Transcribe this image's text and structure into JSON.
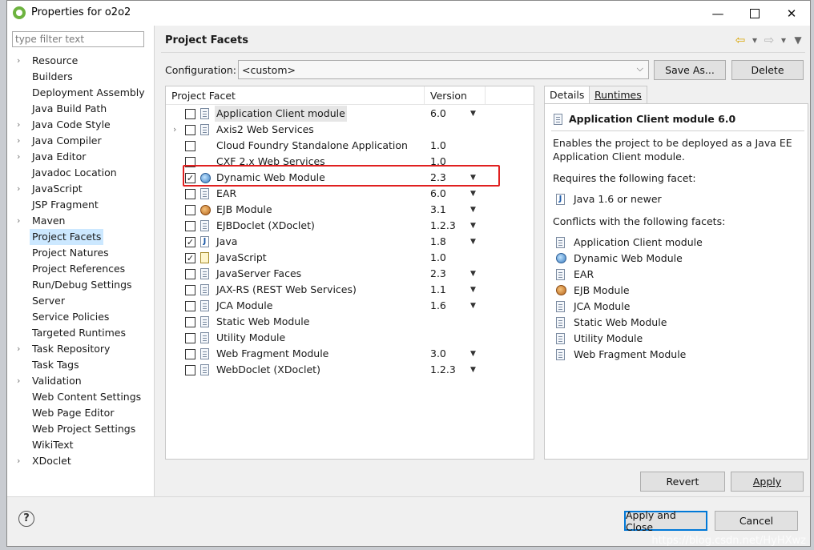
{
  "window": {
    "title": "Properties for o2o2",
    "minimize": "—",
    "close": "✕"
  },
  "filter": {
    "placeholder": "type filter text"
  },
  "tree": [
    {
      "label": "Resource",
      "expandable": true
    },
    {
      "label": "Builders",
      "expandable": false
    },
    {
      "label": "Deployment Assembly",
      "expandable": false
    },
    {
      "label": "Java Build Path",
      "expandable": false
    },
    {
      "label": "Java Code Style",
      "expandable": true
    },
    {
      "label": "Java Compiler",
      "expandable": true
    },
    {
      "label": "Java Editor",
      "expandable": true
    },
    {
      "label": "Javadoc Location",
      "expandable": false
    },
    {
      "label": "JavaScript",
      "expandable": true
    },
    {
      "label": "JSP Fragment",
      "expandable": false
    },
    {
      "label": "Maven",
      "expandable": true
    },
    {
      "label": "Project Facets",
      "expandable": false,
      "selected": true
    },
    {
      "label": "Project Natures",
      "expandable": false
    },
    {
      "label": "Project References",
      "expandable": false
    },
    {
      "label": "Run/Debug Settings",
      "expandable": false
    },
    {
      "label": "Server",
      "expandable": false
    },
    {
      "label": "Service Policies",
      "expandable": false
    },
    {
      "label": "Targeted Runtimes",
      "expandable": false
    },
    {
      "label": "Task Repository",
      "expandable": true
    },
    {
      "label": "Task Tags",
      "expandable": false
    },
    {
      "label": "Validation",
      "expandable": true
    },
    {
      "label": "Web Content Settings",
      "expandable": false
    },
    {
      "label": "Web Page Editor",
      "expandable": false
    },
    {
      "label": "Web Project Settings",
      "expandable": false
    },
    {
      "label": "WikiText",
      "expandable": false
    },
    {
      "label": "XDoclet",
      "expandable": true
    }
  ],
  "header": {
    "title": "Project Facets"
  },
  "configuration": {
    "label": "Configuration:",
    "value": "<custom>",
    "save_as": "Save As...",
    "delete": "Delete"
  },
  "facets": {
    "col_facet": "Project Facet",
    "col_version": "Version",
    "rows": [
      {
        "name": "Application Client module",
        "version": "6.0",
        "checked": false,
        "dropdown": true,
        "icon": "doc",
        "expandable": false
      },
      {
        "name": "Axis2 Web Services",
        "version": "",
        "checked": false,
        "dropdown": false,
        "icon": "doc",
        "expandable": true
      },
      {
        "name": "Cloud Foundry Standalone Application",
        "version": "1.0",
        "checked": false,
        "dropdown": false,
        "icon": "none",
        "expandable": false
      },
      {
        "name": "CXF 2.x Web Services",
        "version": "1.0",
        "checked": false,
        "dropdown": false,
        "icon": "none",
        "expandable": false
      },
      {
        "name": "Dynamic Web Module",
        "version": "2.3",
        "checked": true,
        "dropdown": true,
        "icon": "globe",
        "expandable": false
      },
      {
        "name": "EAR",
        "version": "6.0",
        "checked": false,
        "dropdown": true,
        "icon": "doc",
        "expandable": false
      },
      {
        "name": "EJB Module",
        "version": "3.1",
        "checked": false,
        "dropdown": true,
        "icon": "bean",
        "expandable": false
      },
      {
        "name": "EJBDoclet (XDoclet)",
        "version": "1.2.3",
        "checked": false,
        "dropdown": true,
        "icon": "doc",
        "expandable": false
      },
      {
        "name": "Java",
        "version": "1.8",
        "checked": true,
        "dropdown": true,
        "icon": "java",
        "expandable": false
      },
      {
        "name": "JavaScript",
        "version": "1.0",
        "checked": true,
        "dropdown": false,
        "icon": "js",
        "expandable": false
      },
      {
        "name": "JavaServer Faces",
        "version": "2.3",
        "checked": false,
        "dropdown": true,
        "icon": "doc",
        "expandable": false
      },
      {
        "name": "JAX-RS (REST Web Services)",
        "version": "1.1",
        "checked": false,
        "dropdown": true,
        "icon": "doc",
        "expandable": false
      },
      {
        "name": "JCA Module",
        "version": "1.6",
        "checked": false,
        "dropdown": true,
        "icon": "doc",
        "expandable": false
      },
      {
        "name": "Static Web Module",
        "version": "",
        "checked": false,
        "dropdown": false,
        "icon": "doc",
        "expandable": false
      },
      {
        "name": "Utility Module",
        "version": "",
        "checked": false,
        "dropdown": false,
        "icon": "doc",
        "expandable": false
      },
      {
        "name": "Web Fragment Module",
        "version": "3.0",
        "checked": false,
        "dropdown": true,
        "icon": "doc",
        "expandable": false
      },
      {
        "name": "WebDoclet (XDoclet)",
        "version": "1.2.3",
        "checked": false,
        "dropdown": true,
        "icon": "doc",
        "expandable": false
      }
    ]
  },
  "details": {
    "tab_details": "Details",
    "tab_runtimes": "Runtimes",
    "title": "Application Client module 6.0",
    "description": "Enables the project to be deployed as a Java EE Application Client module.",
    "requires_label": "Requires the following facet:",
    "requires": [
      {
        "name": "Java 1.6 or newer",
        "icon": "java"
      }
    ],
    "conflicts_label": "Conflicts with the following facets:",
    "conflicts": [
      {
        "name": "Application Client module",
        "icon": "doc"
      },
      {
        "name": "Dynamic Web Module",
        "icon": "globe"
      },
      {
        "name": "EAR",
        "icon": "doc"
      },
      {
        "name": "EJB Module",
        "icon": "bean"
      },
      {
        "name": "JCA Module",
        "icon": "doc"
      },
      {
        "name": "Static Web Module",
        "icon": "doc"
      },
      {
        "name": "Utility Module",
        "icon": "doc"
      },
      {
        "name": "Web Fragment Module",
        "icon": "doc"
      }
    ]
  },
  "buttons": {
    "revert": "Revert",
    "apply": "Apply",
    "apply_close": "Apply and Close",
    "cancel": "Cancel"
  },
  "help": "?",
  "watermark": "https://blog.csdn.net/HyHXwz"
}
